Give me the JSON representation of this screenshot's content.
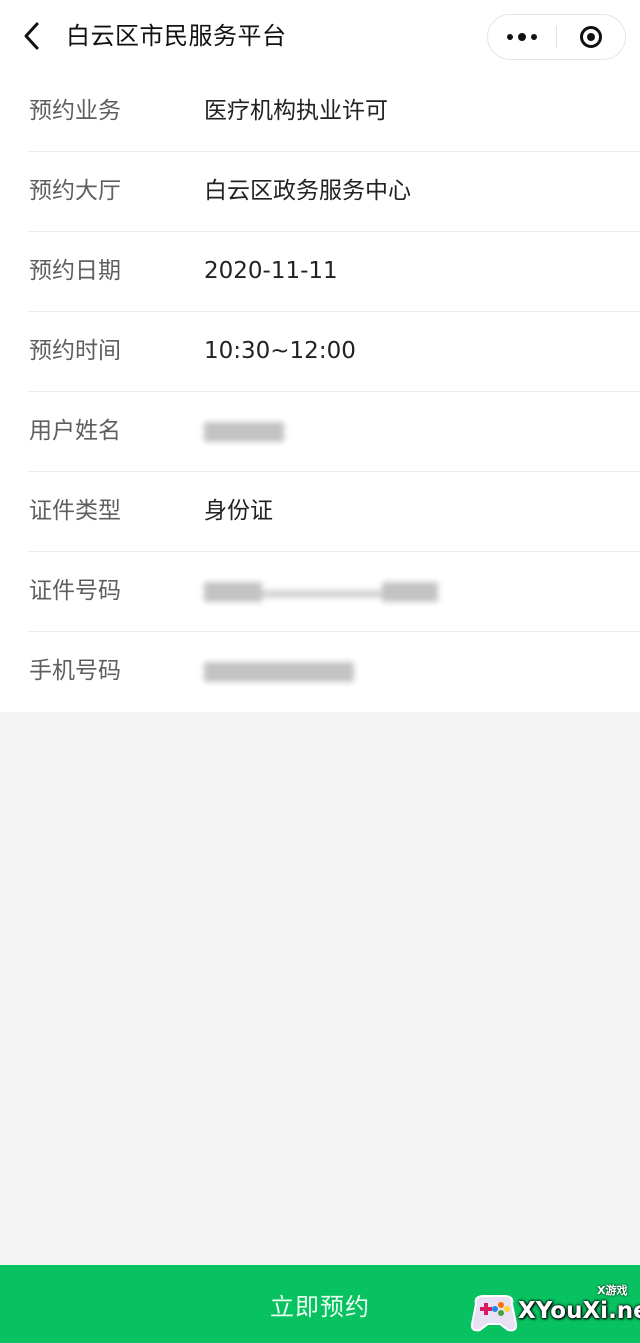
{
  "header": {
    "title": "白云区市民服务平台",
    "more_icon": "more-dots-icon",
    "close_icon": "target-circle-icon"
  },
  "form": {
    "rows": [
      {
        "label": "预约业务",
        "value": "医疗机构执业许可"
      },
      {
        "label": "预约大厅",
        "value": "白云区政务服务中心"
      },
      {
        "label": "预约日期",
        "value": "2020-11-11"
      },
      {
        "label": "预约时间",
        "value": "10:30~12:00"
      },
      {
        "label": "用户姓名",
        "value": null
      },
      {
        "label": "证件类型",
        "value": "身份证"
      },
      {
        "label": "证件号码",
        "value": null
      },
      {
        "label": "手机号码",
        "value": null
      }
    ]
  },
  "submit_label": "立即预约",
  "watermark": {
    "text": "XYouXi.net",
    "small": "X游戏"
  },
  "colors": {
    "accent": "#08c160",
    "background": "#f4f4f4"
  }
}
